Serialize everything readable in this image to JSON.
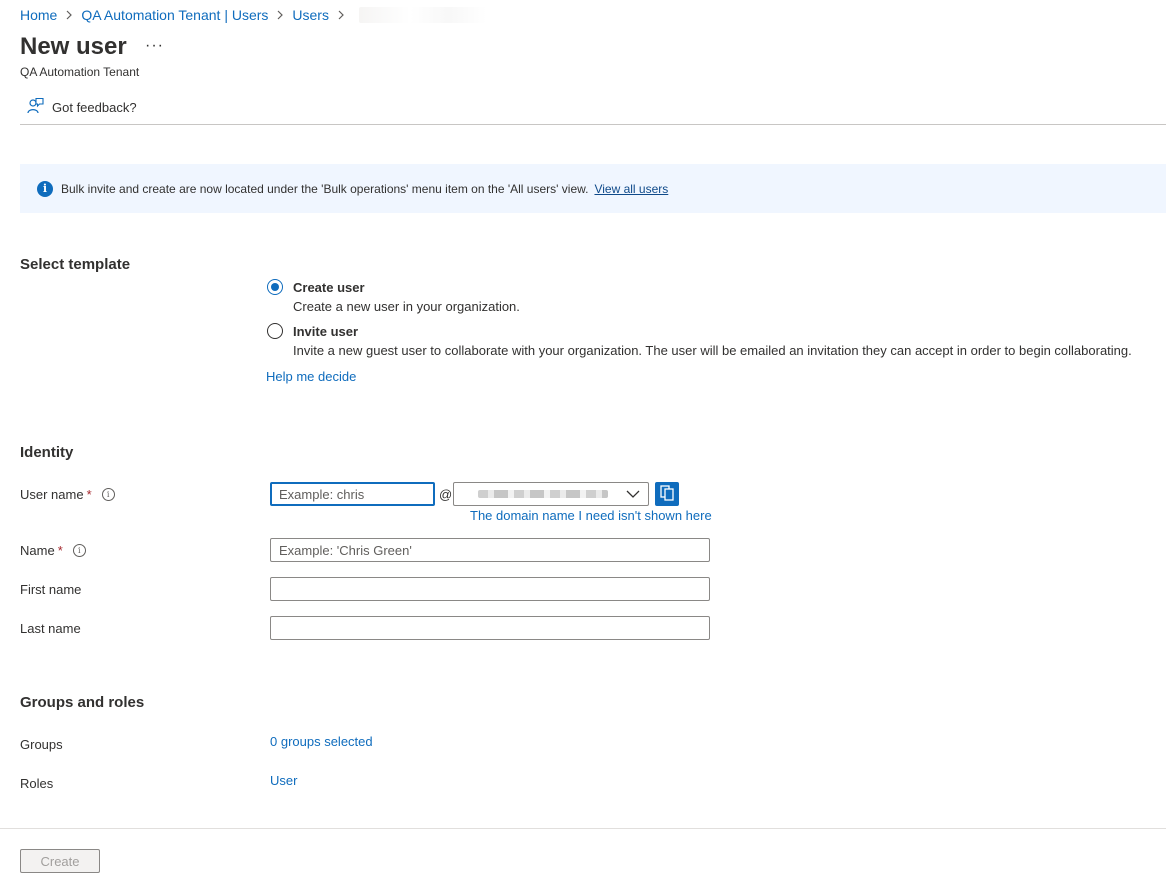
{
  "breadcrumb": {
    "items": [
      "Home",
      "QA Automation Tenant | Users",
      "Users"
    ]
  },
  "header": {
    "title": "New user",
    "more": "···",
    "subtitle": "QA Automation Tenant"
  },
  "toolbar": {
    "feedback_label": "Got feedback?"
  },
  "banner": {
    "message": "Bulk invite and create are now located under the 'Bulk operations' menu item on the 'All users' view.",
    "link": "View all users",
    "icon": "info-icon"
  },
  "template": {
    "title": "Select template",
    "options": [
      {
        "label": "Create user",
        "description": "Create a new user in your organization.",
        "selected": true
      },
      {
        "label": "Invite user",
        "description": "Invite a new guest user to collaborate with your organization. The user will be emailed an invitation they can accept in order to begin collaborating.",
        "selected": false
      }
    ],
    "help_link": "Help me decide"
  },
  "identity": {
    "title": "Identity",
    "username": {
      "label": "User name",
      "required": "*",
      "placeholder": "Example: chris",
      "value": ""
    },
    "at_symbol": "@",
    "domain_link": "The domain name I need isn't shown here",
    "name": {
      "label": "Name",
      "required": "*",
      "placeholder": "Example: 'Chris Green'",
      "value": ""
    },
    "first_name": {
      "label": "First name",
      "value": ""
    },
    "last_name": {
      "label": "Last name",
      "value": ""
    }
  },
  "groups_roles": {
    "title": "Groups and roles",
    "groups_label": "Groups",
    "groups_value": "0 groups selected",
    "roles_label": "Roles",
    "roles_value": "User"
  },
  "footer": {
    "create_label": "Create"
  },
  "colors": {
    "accent": "#0f6cbd",
    "banner_bg": "#f0f6ff",
    "required": "#a4262c"
  }
}
